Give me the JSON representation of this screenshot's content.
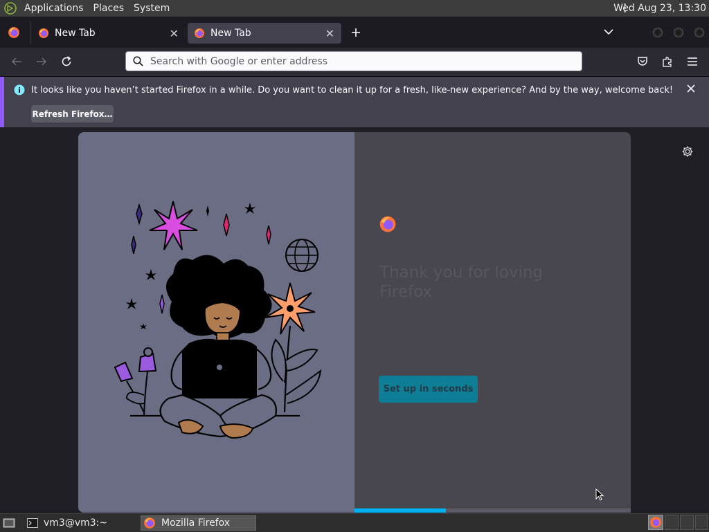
{
  "top_panel": {
    "menus": [
      "Applications",
      "Places",
      "System"
    ],
    "clock": "Wed Aug 23, 13:30"
  },
  "tabs": [
    {
      "title": "New Tab"
    },
    {
      "title": "New Tab"
    }
  ],
  "urlbar": {
    "placeholder": "Search with Google or enter address"
  },
  "notification": {
    "message": "It looks like you haven’t started Firefox in a while. Do you want to clean it up for a fresh, like-new experience? And by the way, welcome back!",
    "button_label": "Refresh Firefox…"
  },
  "welcome": {
    "title": "Thank you for loving Firefox",
    "subtitle": "",
    "button_label": "Set up in seconds",
    "progress": 0.33
  },
  "taskbar": {
    "terminal_label": "vm3@vm3:~",
    "firefox_label": "Mozilla Firefox"
  },
  "colors": {
    "accent": "#00b3f4",
    "notification_stripe": "#9059ff",
    "setup_button": "#0e7e96"
  }
}
